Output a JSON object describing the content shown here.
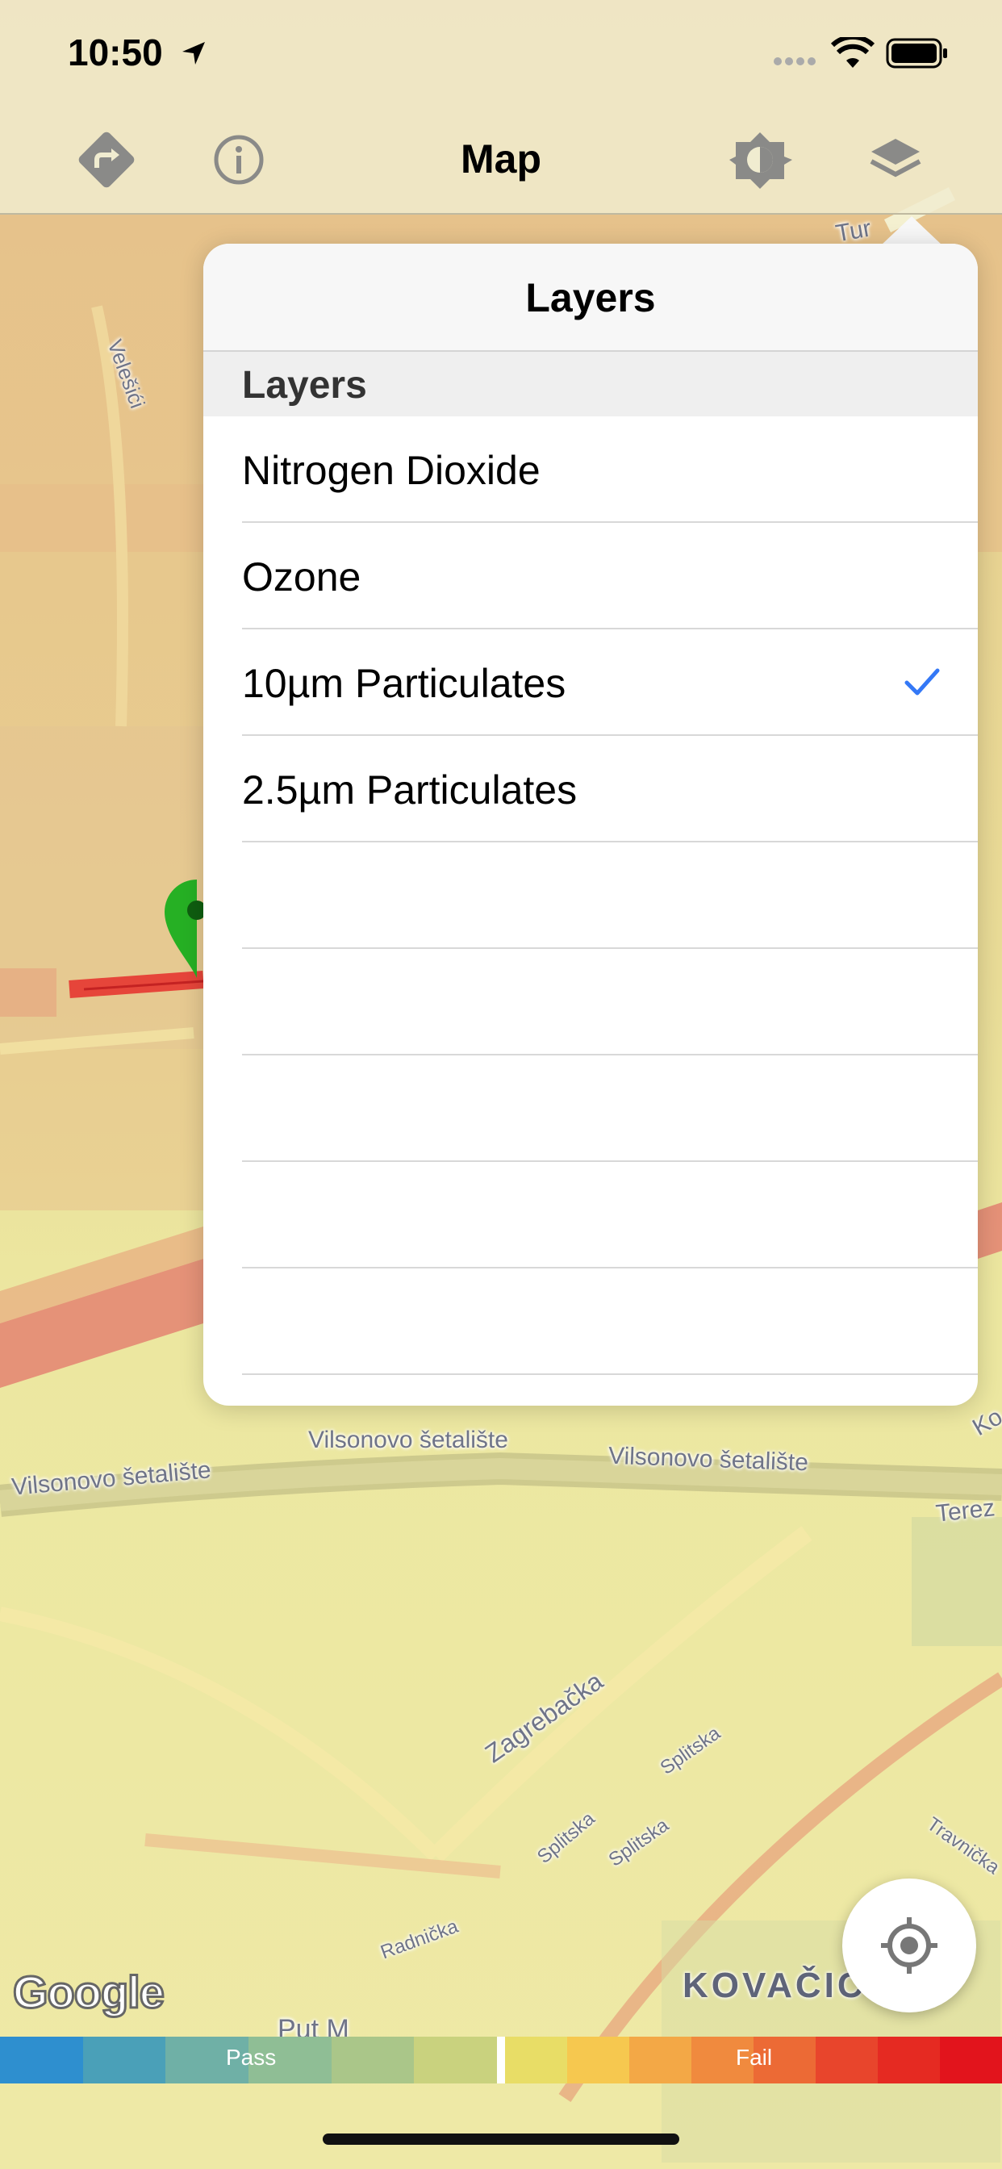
{
  "status_bar": {
    "time": "10:50"
  },
  "nav": {
    "title": "Map",
    "icons": [
      "directions-icon",
      "info-icon",
      "brightness-icon",
      "layers-icon"
    ]
  },
  "popover": {
    "title": "Layers",
    "section_header": "Layers",
    "rows": [
      {
        "label": "Nitrogen Dioxide",
        "selected": false
      },
      {
        "label": "Ozone",
        "selected": false
      },
      {
        "label": "10µm Particulates",
        "selected": true
      },
      {
        "label": "2.5µm Particulates",
        "selected": false
      },
      {
        "label": "",
        "selected": false
      },
      {
        "label": "",
        "selected": false
      },
      {
        "label": "",
        "selected": false
      },
      {
        "label": "",
        "selected": false
      },
      {
        "label": "",
        "selected": false
      }
    ],
    "check_color": "#3478f6"
  },
  "map": {
    "street_labels": {
      "velesici": "Velešići",
      "vilsonovo_1": "Vilsonovo šetalište",
      "vilsonovo_2": "Vilsonovo šetalište",
      "vilsonovo_3": "Vilsonovo šetalište",
      "terez": "Terez",
      "zagrebacka": "Zagrebačka",
      "splitska_1": "Splitska",
      "splitska_2": "Splitska",
      "splitska_3": "Splitska",
      "radnicka": "Radnička",
      "travnicka": "Travnička",
      "put_m": "Put M",
      "ko": "Ko",
      "tur": "Tur"
    },
    "district_label": "KOVAČIĆ",
    "attribution": "Google"
  },
  "legend": {
    "pass_label": "Pass",
    "fail_label": "Fail",
    "pass_colors": [
      "#2e8fcf",
      "#4aa0b8",
      "#6fb0a6",
      "#8fbe95",
      "#aac689",
      "#c9d27e"
    ],
    "fail_colors": [
      "#e8dd66",
      "#f6c84f",
      "#f3a846",
      "#f08a3e",
      "#ec6a35",
      "#e8452c",
      "#e52a22",
      "#e2141c"
    ]
  }
}
